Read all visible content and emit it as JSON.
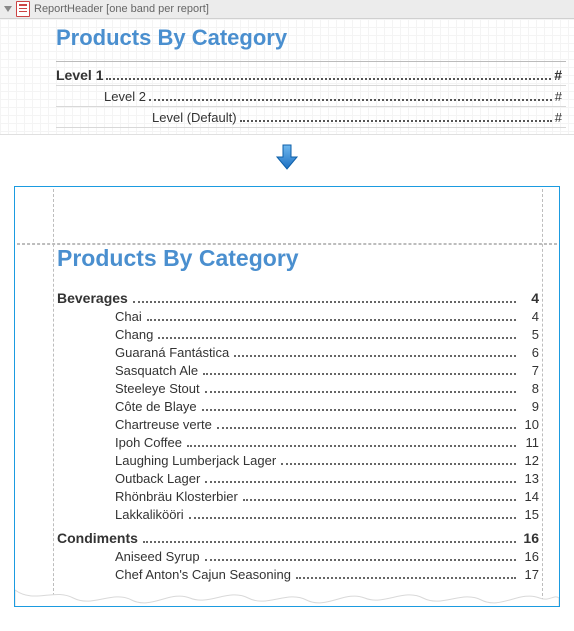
{
  "designer": {
    "band_label": "ReportHeader [one band per report]",
    "title": "Products By Category",
    "rows": [
      {
        "indent": "lvl1",
        "label": "Level 1",
        "page": "#"
      },
      {
        "indent": "lvl2",
        "label": "Level 2",
        "page": "#"
      },
      {
        "indent": "lvl3",
        "label": "Level (Default)",
        "page": "#"
      }
    ]
  },
  "preview": {
    "title": "Products By Category",
    "sections": [
      {
        "category": "Beverages",
        "page": "4",
        "items": [
          {
            "name": "Chai",
            "page": "4"
          },
          {
            "name": "Chang",
            "page": "5"
          },
          {
            "name": "Guaraná Fantástica",
            "page": "6"
          },
          {
            "name": "Sasquatch Ale",
            "page": "7"
          },
          {
            "name": "Steeleye Stout",
            "page": "8"
          },
          {
            "name": "Côte de Blaye",
            "page": "9"
          },
          {
            "name": "Chartreuse verte",
            "page": "10"
          },
          {
            "name": "Ipoh Coffee",
            "page": "11"
          },
          {
            "name": "Laughing Lumberjack Lager",
            "page": "12"
          },
          {
            "name": "Outback Lager",
            "page": "13"
          },
          {
            "name": "Rhönbräu Klosterbier",
            "page": "14"
          },
          {
            "name": "Lakkalikööri",
            "page": "15"
          }
        ]
      },
      {
        "category": "Condiments",
        "page": "16",
        "items": [
          {
            "name": "Aniseed Syrup",
            "page": "16"
          },
          {
            "name": "Chef Anton's Cajun Seasoning",
            "page": "17"
          }
        ]
      }
    ]
  }
}
